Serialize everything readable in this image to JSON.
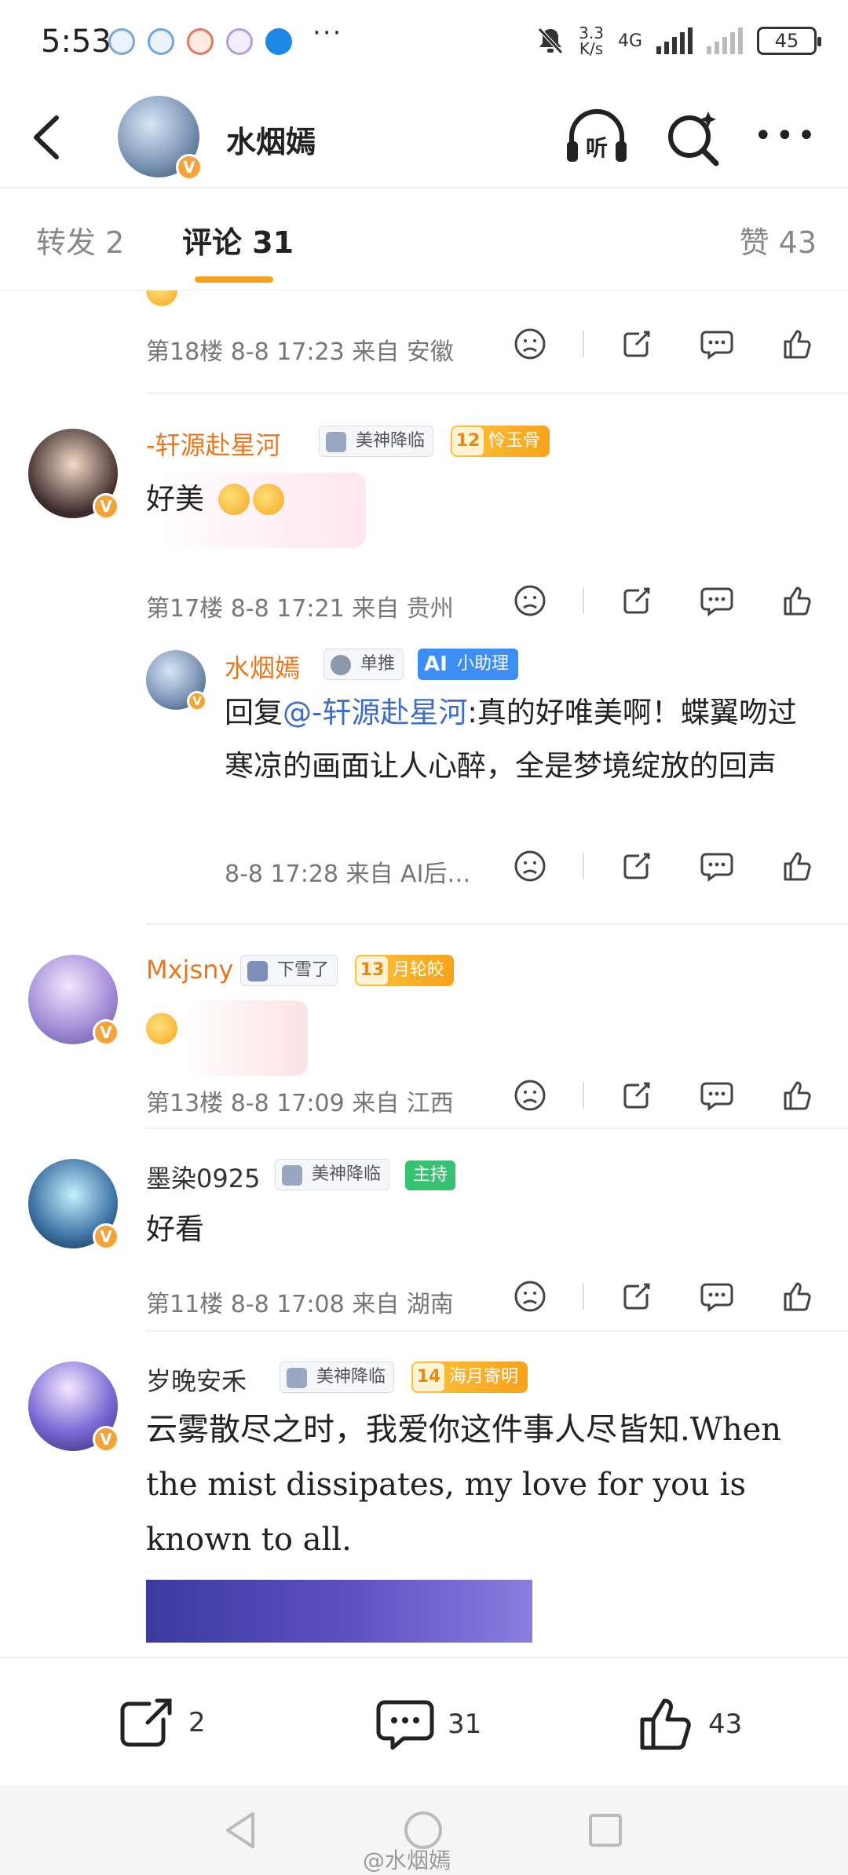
{
  "status_bar": {
    "time": "5:53",
    "more": "···",
    "net_speed_value": "3.3",
    "net_speed_unit": "K/s",
    "network": "4G",
    "battery": "45"
  },
  "header": {
    "title": "水烟嫣",
    "verified_mark": "V"
  },
  "tabs": {
    "repost": "转发 2",
    "comment": "评论 31",
    "like": "赞 43"
  },
  "comments": [
    {
      "meta": "第18楼 8-8 17:23 来自 安徽"
    },
    {
      "username": "-轩源赴星河",
      "badge": "美神降临",
      "fan_level": "12",
      "fan_name": "怜玉骨",
      "text": "好美",
      "meta": "第17楼 8-8 17:21 来自 贵州",
      "reply": {
        "username": "水烟嫣",
        "badge": "单推",
        "ai_label": "小助理",
        "ai_icon": "AI",
        "text_prefix": "回复",
        "mention": "@-轩源赴星河",
        "text": ":真的好唯美啊！蝶翼吻过寒凉的画面让人心醉，全是梦境绽放的回声",
        "meta": "8-8 17:28 来自 AI后…"
      }
    },
    {
      "username": "Mxjsny",
      "badge": "下雪了",
      "fan_level": "13",
      "fan_name": "月轮皎",
      "meta": "第13楼 8-8 17:09 来自 江西"
    },
    {
      "username": "墨染0925",
      "badge": "美神降临",
      "role": "主持",
      "text": "好看",
      "meta": "第11楼 8-8 17:08 来自 湖南"
    },
    {
      "username": "岁晚安禾",
      "badge": "美神降临",
      "fan_level": "14",
      "fan_name": "海月寄明",
      "text": "云雾散尽之时，我爱你这件事人尽皆知.When the mist dissipates, my love for you is known to all."
    }
  ],
  "bottom_bar": {
    "share_count": "2",
    "comment_count": "31",
    "like_count": "43"
  },
  "watermark": "@水烟嫣",
  "colors": {
    "accent": "#f7a21b",
    "username_orange": "#e8761d",
    "mention_blue": "#3f6cc4",
    "host_green": "#38c172",
    "ai_blue": "#3c8ef5"
  },
  "icons": [
    "back-icon",
    "listen-icon",
    "search-icon",
    "more-icon",
    "dislike-icon",
    "share-icon",
    "comment-icon",
    "like-icon",
    "triangle-back-icon",
    "circle-home-icon",
    "square-recents-icon"
  ]
}
